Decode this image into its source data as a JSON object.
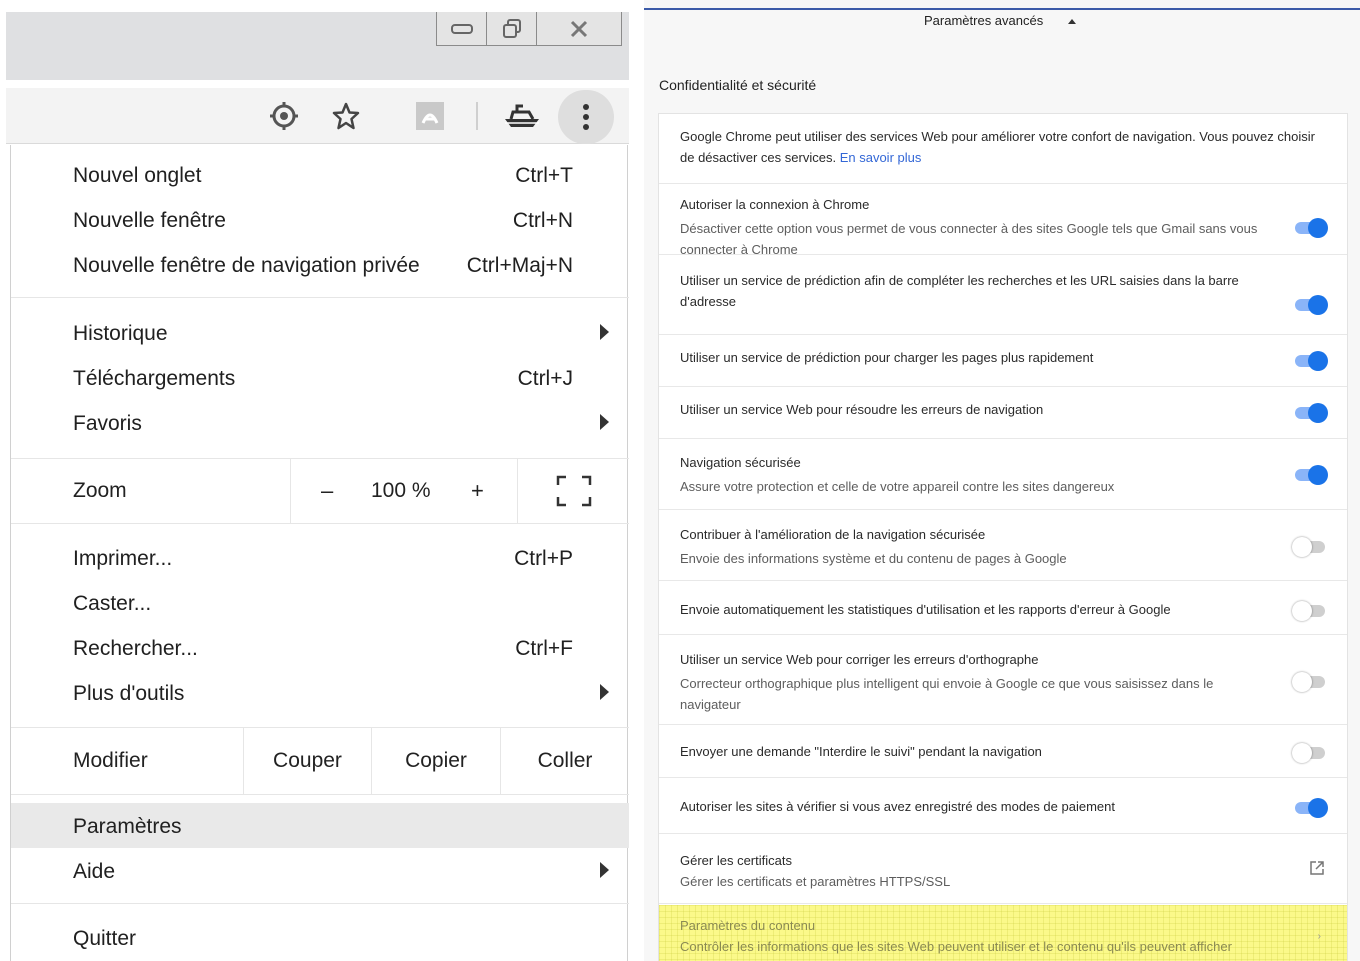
{
  "window_controls": {
    "minimize": "▭",
    "restore": "⧉",
    "close": "✕"
  },
  "toolbar": {
    "icons": [
      "location-target-icon",
      "star-bookmark-icon",
      "pdf-extension-icon",
      "ship-extension-icon",
      "kebab-menu-icon"
    ]
  },
  "menu": {
    "new_tab": {
      "label": "Nouvel onglet",
      "shortcut": "Ctrl+T"
    },
    "new_window": {
      "label": "Nouvelle fenêtre",
      "shortcut": "Ctrl+N"
    },
    "incognito": {
      "label": "Nouvelle fenêtre de navigation privée",
      "shortcut": "Ctrl+Maj+N"
    },
    "history": {
      "label": "Historique"
    },
    "downloads": {
      "label": "Téléchargements",
      "shortcut": "Ctrl+J"
    },
    "bookmarks": {
      "label": "Favoris"
    },
    "zoom": {
      "label": "Zoom",
      "minus": "–",
      "value": "100 %",
      "plus": "+"
    },
    "print": {
      "label": "Imprimer...",
      "shortcut": "Ctrl+P"
    },
    "cast": {
      "label": "Caster..."
    },
    "find": {
      "label": "Rechercher...",
      "shortcut": "Ctrl+F"
    },
    "more_tools": {
      "label": "Plus d'outils"
    },
    "edit": {
      "label": "Modifier",
      "cut": "Couper",
      "copy": "Copier",
      "paste": "Coller"
    },
    "settings": {
      "label": "Paramètres"
    },
    "help": {
      "label": "Aide"
    },
    "quit": {
      "label": "Quitter"
    }
  },
  "settings": {
    "advanced": "Paramètres avancés",
    "section_title": "Confidentialité et sécurité",
    "intro": "Google Chrome peut utiliser des services Web pour améliorer votre confort de navigation. Vous pouvez choisir de désactiver ces services.",
    "intro_link": "En savoir plus",
    "rows": [
      {
        "title": "Autoriser la connexion à Chrome",
        "desc": "Désactiver cette option vous permet de vous connecter à des sites Google tels que Gmail sans vous connecter à Chrome",
        "toggle": true
      },
      {
        "title": "Utiliser un service de prédiction afin de compléter les recherches et les URL saisies dans la barre d'adresse",
        "desc": "",
        "toggle": true
      },
      {
        "title": "Utiliser un service de prédiction pour charger les pages plus rapidement",
        "desc": "",
        "toggle": true
      },
      {
        "title": "Utiliser un service Web pour résoudre les erreurs de navigation",
        "desc": "",
        "toggle": true
      },
      {
        "title": "Navigation sécurisée",
        "desc": "Assure votre protection et celle de votre appareil contre les sites dangereux",
        "toggle": true
      },
      {
        "title": "Contribuer à l'amélioration de la navigation sécurisée",
        "desc": "Envoie des informations système et du contenu de pages à Google",
        "toggle": false
      },
      {
        "title": "Envoie automatiquement les statistiques d'utilisation et les rapports d'erreur à Google",
        "desc": "",
        "toggle": false
      },
      {
        "title": "Utiliser un service Web pour corriger les erreurs d'orthographe",
        "desc": "Correcteur orthographique plus intelligent qui envoie à Google ce que vous saisissez dans le navigateur",
        "toggle": false
      },
      {
        "title": "Envoyer une demande \"Interdire le suivi\" pendant la navigation",
        "desc": "",
        "toggle": false
      },
      {
        "title": "Autoriser les sites à vérifier si vous avez enregistré des modes de paiement",
        "desc": "",
        "toggle": true
      }
    ],
    "certificates": {
      "title": "Gérer les certificats",
      "desc": "Gérer les certificats et paramètres HTTPS/SSL"
    },
    "content": {
      "title": "Paramètres du contenu",
      "desc": "Contrôler les informations que les sites Web peuvent utiliser et le contenu qu'ils peuvent afficher"
    },
    "colors": {
      "toggle_on": "#1a73e8",
      "toggle_off": "#cfcfcf",
      "highlight": "#fbf98a",
      "link": "#3367d6"
    }
  }
}
